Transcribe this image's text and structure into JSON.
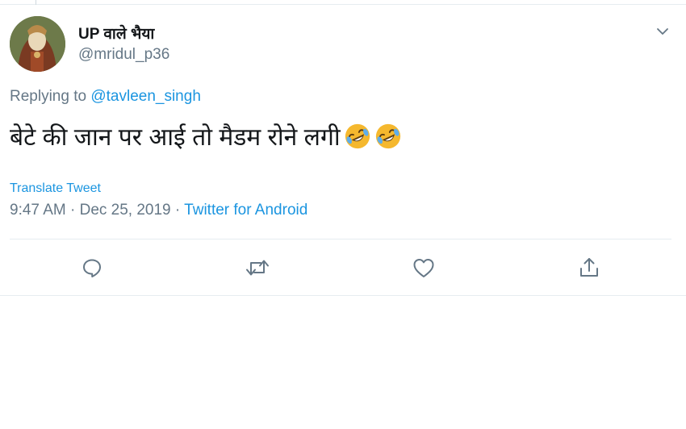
{
  "tweet": {
    "display_name": "UP वाले भैया",
    "handle": "@mridul_p36",
    "replying_prefix": "Replying to",
    "replying_to": "@tavleen_singh",
    "text": "बेटे की जान पर आई तो मैडम रोने लगी",
    "emoji_count": 2,
    "translate_label": "Translate Tweet",
    "time": "9:47 AM · Dec 25, 2019 · ",
    "source": "Twitter for Android"
  },
  "icons": {
    "caret": "chevron-down-icon",
    "emoji": "rolling-on-floor-laughing-emoji",
    "actions": [
      "reply-icon",
      "retweet-icon",
      "like-icon",
      "share-icon"
    ]
  },
  "colors": {
    "link": "#1b95e0",
    "secondary_text": "#657786",
    "primary_text": "#14171a",
    "divider": "#e6ecf0"
  }
}
